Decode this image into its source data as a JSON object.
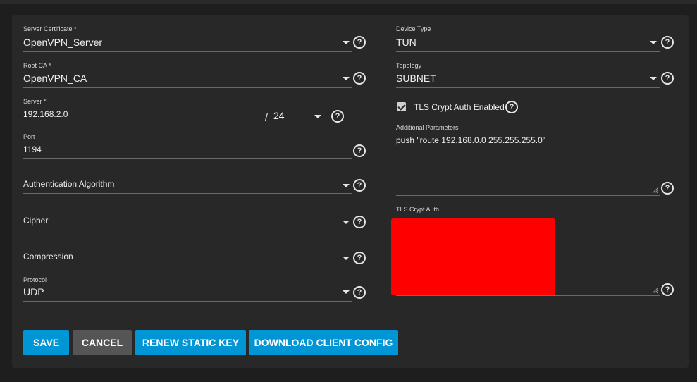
{
  "form": {
    "server_certificate": {
      "label": "Server Certificate *",
      "value": "OpenVPN_Server"
    },
    "root_ca": {
      "label": "Root CA *",
      "value": "OpenVPN_CA"
    },
    "server": {
      "label": "Server *",
      "value": "192.168.2.0",
      "separator": "/",
      "netmask": "24"
    },
    "port": {
      "label": "Port",
      "value": "1194"
    },
    "auth_algorithm": {
      "label": "Authentication Algorithm",
      "value": ""
    },
    "cipher": {
      "label": "Cipher",
      "value": ""
    },
    "compression": {
      "label": "Compression",
      "value": ""
    },
    "protocol": {
      "label": "Protocol",
      "value": "UDP"
    },
    "device_type": {
      "label": "Device Type",
      "value": "TUN"
    },
    "topology": {
      "label": "Topology",
      "value": "SUBNET"
    },
    "tls_crypt_auth_enabled": {
      "label": "TLS Crypt Auth Enabled",
      "checked": true
    },
    "additional_parameters": {
      "label": "Additional Parameters",
      "value": "push \"route 192.168.0.0 255.255.255.0\""
    },
    "tls_crypt_auth": {
      "label": "TLS Crypt Auth",
      "value_redacted": true
    }
  },
  "buttons": {
    "save": "SAVE",
    "cancel": "CANCEL",
    "renew_static_key": "RENEW STATIC KEY",
    "download_client_config": "DOWNLOAD CLIENT CONFIG"
  },
  "help_glyph": "?",
  "colors": {
    "accent": "#0095d5",
    "cancel": "#555555",
    "redaction": "#ff0000"
  }
}
